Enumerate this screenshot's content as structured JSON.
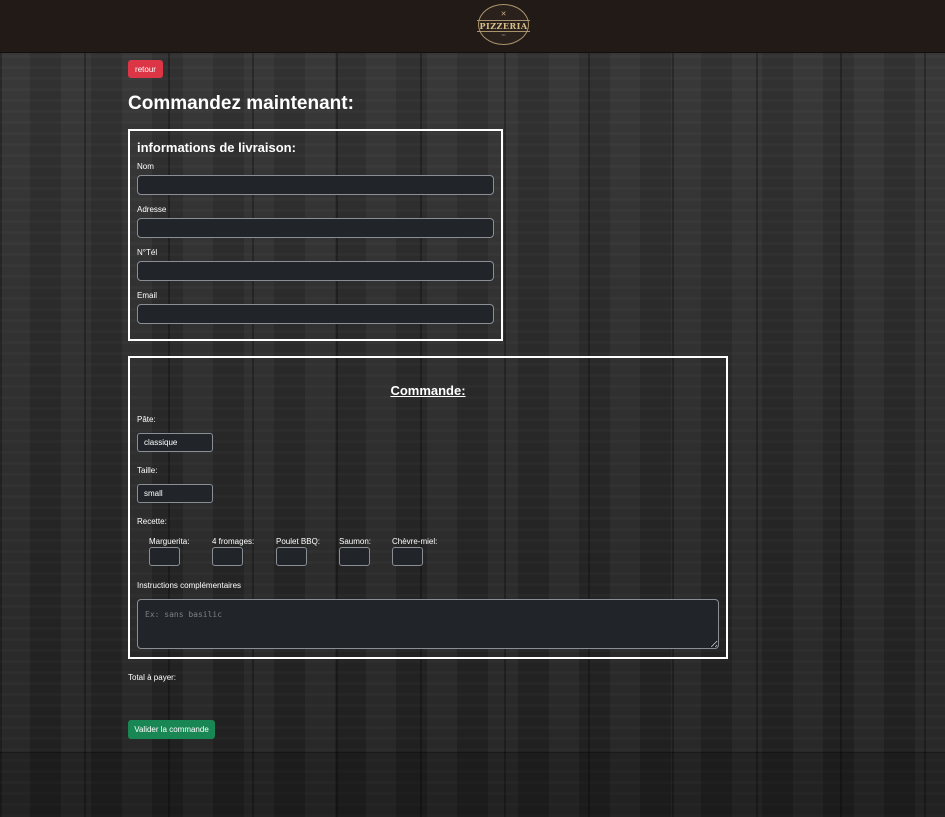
{
  "header": {
    "logo_text": "PIZZERIA"
  },
  "back_button": "retour",
  "page_title": "Commandez maintenant:",
  "delivery": {
    "title": "informations de livraison:",
    "fields": [
      {
        "label": "Nom",
        "value": ""
      },
      {
        "label": "Adresse",
        "value": ""
      },
      {
        "label": "N°Tél",
        "value": ""
      },
      {
        "label": "Email",
        "value": ""
      }
    ]
  },
  "order": {
    "title": "Commande:",
    "dough_label": "Pâte:",
    "dough_value": "classique",
    "size_label": "Taille:",
    "size_value": "small",
    "recipe_label": "Recette:",
    "recipes": [
      {
        "label": "Marguerita:",
        "value": ""
      },
      {
        "label": "4 fromages:",
        "value": ""
      },
      {
        "label": "Poulet BBQ:",
        "value": ""
      },
      {
        "label": "Saumon:",
        "value": ""
      },
      {
        "label": "Chèvre-miel:",
        "value": ""
      }
    ],
    "instructions_label": "Instructions complémentaires",
    "instructions_placeholder": "Ex: sans basilic"
  },
  "total_label": "Total à payer:",
  "submit_button": "Valider la commande",
  "colors": {
    "header_bg": "#221a17",
    "danger": "#dc3545",
    "success": "#198754",
    "input_bg": "#212529"
  }
}
